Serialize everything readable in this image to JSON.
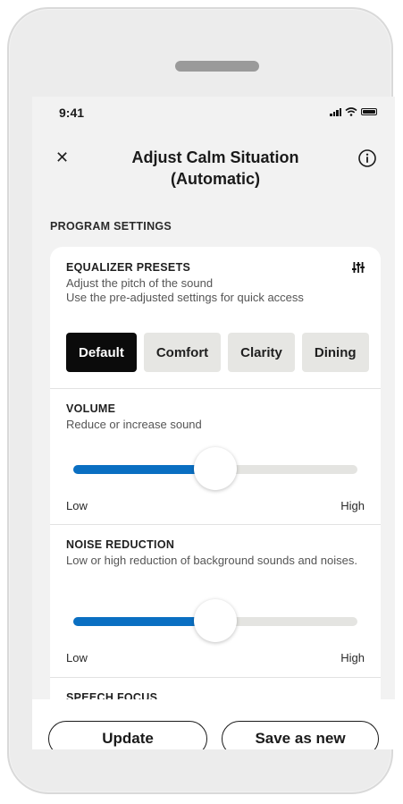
{
  "status_bar": {
    "time": "9:41"
  },
  "nav": {
    "close_glyph": "✕",
    "title": "Adjust Calm Situation (Automatic)",
    "info_icon": "info-icon"
  },
  "section_title": "PROGRAM SETTINGS",
  "equalizer": {
    "title": "EQUALIZER PRESETS",
    "description": "Adjust the pitch of the sound\nUse the pre-adjusted settings for quick access",
    "presets": [
      {
        "label": "Default",
        "selected": true
      },
      {
        "label": "Comfort",
        "selected": false
      },
      {
        "label": "Clarity",
        "selected": false
      },
      {
        "label": "Dining",
        "selected": false
      }
    ]
  },
  "volume": {
    "title": "VOLUME",
    "description": "Reduce or increase sound",
    "low_label": "Low",
    "high_label": "High",
    "value": 0.5
  },
  "noise_reduction": {
    "title": "NOISE REDUCTION",
    "description": "Low or high reduction of background sounds and noises.",
    "low_label": "Low",
    "high_label": "High",
    "value": 0.5
  },
  "speech_focus": {
    "title": "SPEECH FOCUS"
  },
  "actions": {
    "update_label": "Update",
    "save_new_label": "Save as new"
  },
  "colors": {
    "accent": "#0a6fc2",
    "selected_chip": "#0b0b0b",
    "chip": "#e6e6e3"
  }
}
